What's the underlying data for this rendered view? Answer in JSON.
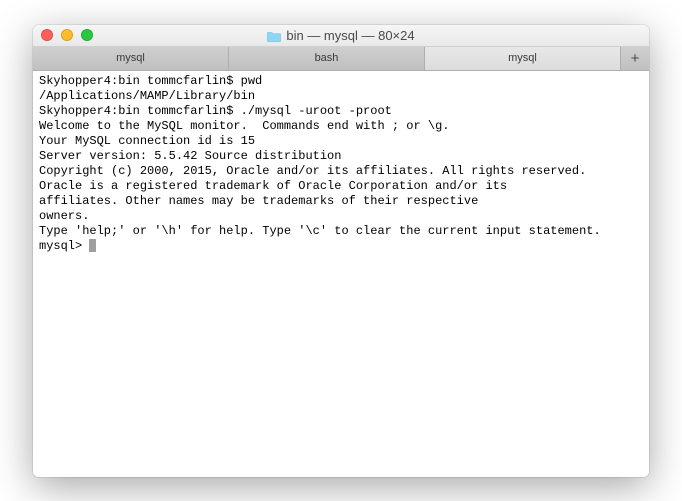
{
  "titlebar": {
    "title": "bin — mysql — 80×24",
    "folder_icon": "folder-icon"
  },
  "tabs": {
    "items": [
      "mysql",
      "bash",
      "mysql"
    ],
    "active_index": 2,
    "plus": "+"
  },
  "terminal": {
    "lines": [
      "Skyhopper4:bin tommcfarlin$ pwd",
      "/Applications/MAMP/Library/bin",
      "Skyhopper4:bin tommcfarlin$ ./mysql -uroot -proot",
      "Welcome to the MySQL monitor.  Commands end with ; or \\g.",
      "Your MySQL connection id is 15",
      "Server version: 5.5.42 Source distribution",
      "",
      "Copyright (c) 2000, 2015, Oracle and/or its affiliates. All rights reserved.",
      "",
      "Oracle is a registered trademark of Oracle Corporation and/or its",
      "affiliates. Other names may be trademarks of their respective",
      "owners.",
      "",
      "Type 'help;' or '\\h' for help. Type '\\c' to clear the current input statement.",
      ""
    ],
    "prompt": "mysql> "
  }
}
